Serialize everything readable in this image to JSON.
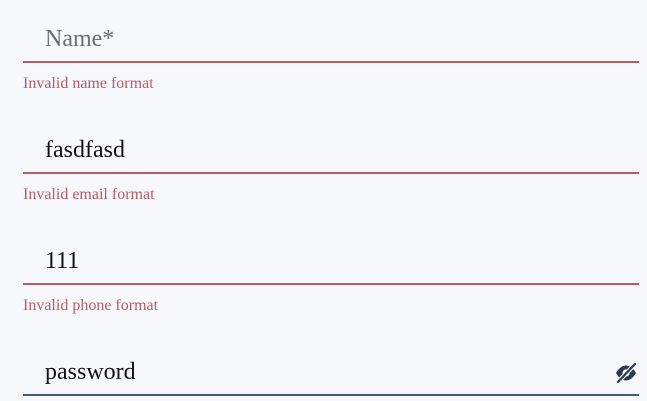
{
  "form": {
    "name": {
      "value": "",
      "placeholder": "Name*",
      "error": "Invalid name format"
    },
    "email": {
      "value": "fasdfasd",
      "placeholder": "",
      "error": "Invalid email format"
    },
    "phone": {
      "value": "111",
      "placeholder": "",
      "error": "Invalid phone format"
    },
    "password": {
      "value": "password",
      "placeholder": "",
      "toggle_icon": "eye-slash-icon"
    }
  },
  "colors": {
    "background": "#f7f8fc",
    "error": "#b85c63",
    "underline_neutral": "#4a5a78",
    "icon": "#2f3a52",
    "text": "#111111",
    "placeholder": "#6e6e72"
  }
}
